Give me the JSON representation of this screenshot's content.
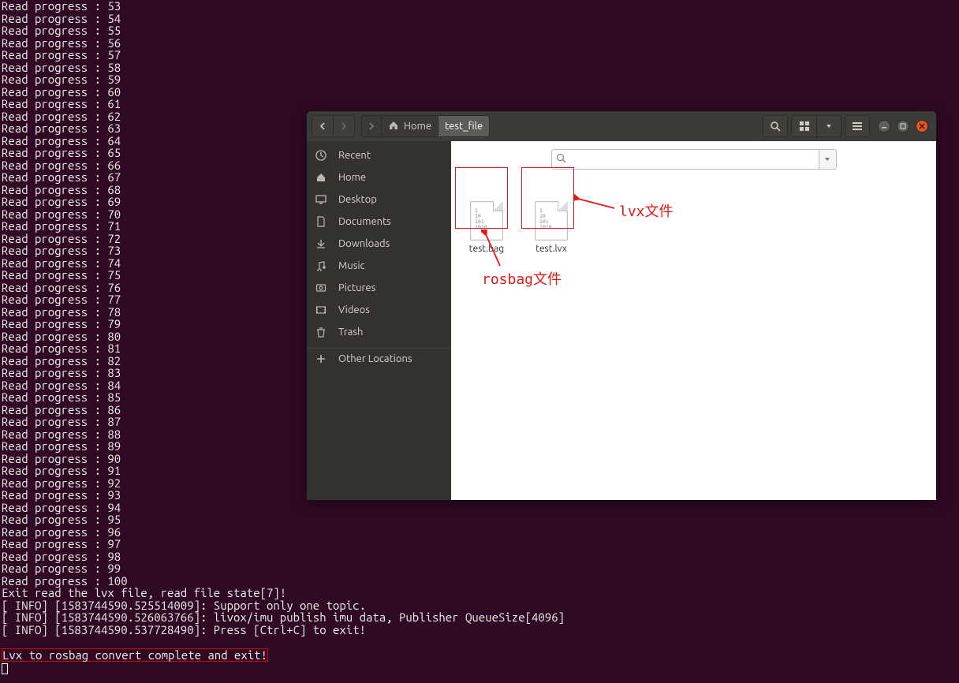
{
  "terminal": {
    "progress_label": "Read progress : ",
    "progress_start": 53,
    "progress_end": 100,
    "lines_after": [
      "Exit read the lvx file, read file state[7]!",
      "[ INFO] [1583744590.525514009]: Support only one topic.",
      "[ INFO] [1583744590.526063766]: livox/imu publish imu data, Publisher QueueSize[4096]",
      "[ INFO] [1583744590.537728490]: Press [Ctrl+C] to exit!",
      ""
    ],
    "highlight_line": "Lvx to rosbag convert complete and exit!"
  },
  "fm": {
    "breadcrumb": {
      "home": "Home",
      "current": "test_file"
    },
    "sidebar": [
      {
        "icon": "clock",
        "label": "Recent"
      },
      {
        "icon": "home",
        "label": "Home"
      },
      {
        "icon": "desktop",
        "label": "Desktop"
      },
      {
        "icon": "doc",
        "label": "Documents"
      },
      {
        "icon": "download",
        "label": "Downloads"
      },
      {
        "icon": "music",
        "label": "Music"
      },
      {
        "icon": "picture",
        "label": "Pictures"
      },
      {
        "icon": "video",
        "label": "Videos"
      },
      {
        "icon": "trash",
        "label": "Trash"
      },
      {
        "icon": "plus",
        "label": "Other Locations"
      }
    ],
    "search_placeholder": "",
    "files": [
      {
        "name": "test.bag"
      },
      {
        "name": "test.lvx"
      }
    ]
  },
  "annotations": {
    "lvx_label": "lvx文件",
    "rosbag_label": "rosbag文件"
  }
}
